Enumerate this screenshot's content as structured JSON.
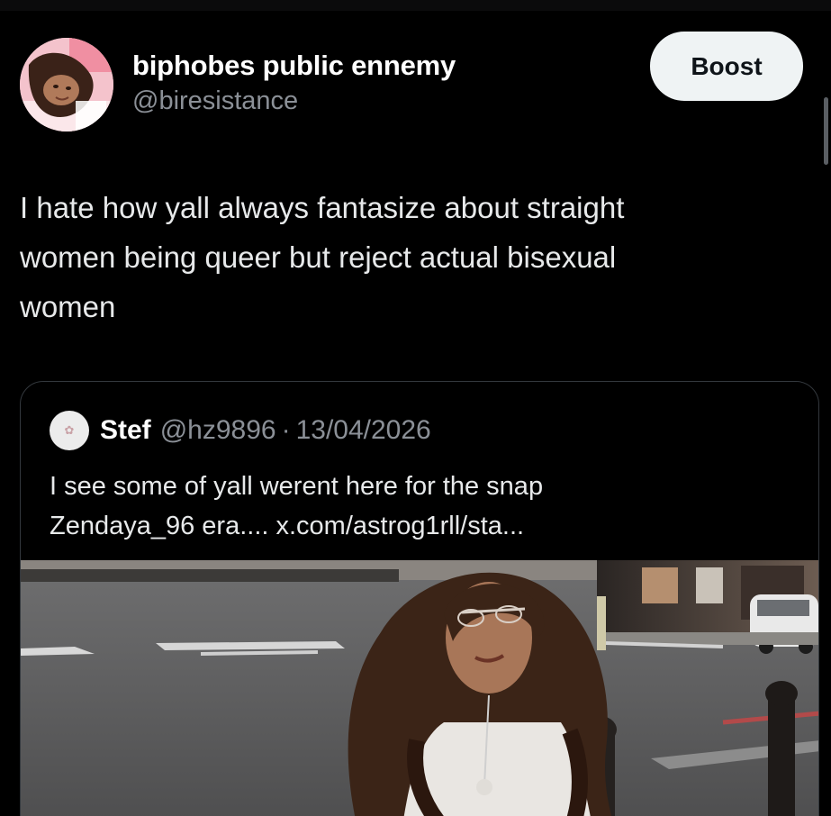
{
  "post": {
    "author": {
      "display_name": "biphobes public ennemy",
      "handle": "@biresistance",
      "avatar_icon": "profile-photo"
    },
    "boost_label": "Boost",
    "text": "I hate how yall always fantasize about straight\nwomen being queer but reject actual bisexual\nwomen"
  },
  "quoted_post": {
    "author": {
      "display_name": "Stef",
      "handle": "@hz9896",
      "avatar_icon": "profile-photo"
    },
    "separator": "·",
    "date": "13/04/2026",
    "text_lines": [
      "I see some of yall werent here for the snap",
      "Zendaya_96 era.... x.com/astrog1rll/sta..."
    ],
    "media_icon": "street-photo"
  },
  "colors": {
    "background": "#000000",
    "text_primary": "#e7e9ea",
    "text_secondary": "#8b9097",
    "button_bg": "#eff3f4",
    "card_border": "#33383d"
  }
}
